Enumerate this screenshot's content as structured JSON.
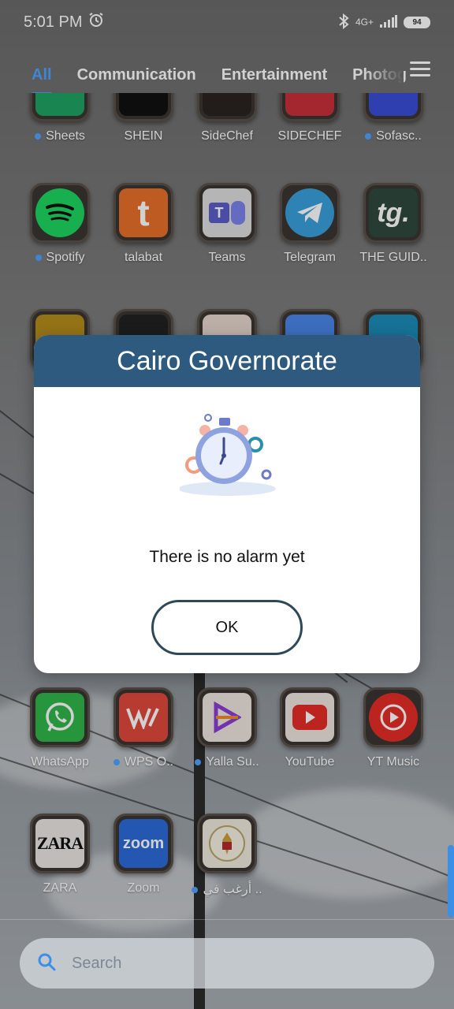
{
  "status_bar": {
    "time": "5:01 PM",
    "network": "4G+",
    "battery": "94"
  },
  "tabs": [
    {
      "label": "All"
    },
    {
      "label": "Communication"
    },
    {
      "label": "Entertainment"
    },
    {
      "label": "Photog"
    }
  ],
  "apps": {
    "row0": [
      {
        "label": "Sheets",
        "dot": true
      },
      {
        "label": "SHEIN",
        "dot": false
      },
      {
        "label": "SideChef",
        "dot": false
      },
      {
        "label": "SIDECHEF",
        "dot": false
      },
      {
        "label": "Sofasc..",
        "dot": true
      }
    ],
    "row1": [
      {
        "label": "Spotify",
        "dot": true
      },
      {
        "label": "talabat",
        "dot": false
      },
      {
        "label": "Teams",
        "dot": false
      },
      {
        "label": "Telegram",
        "dot": false
      },
      {
        "label": "THE GUID..",
        "dot": false
      }
    ],
    "row_wa": [
      {
        "label": "WhatsApp",
        "dot": false
      },
      {
        "label": "WPS O..",
        "dot": true
      },
      {
        "label": "Yalla Su..",
        "dot": true
      },
      {
        "label": "YouTube",
        "dot": false
      },
      {
        "label": "YT Music",
        "dot": false
      }
    ],
    "row_last": [
      {
        "label": "ZARA",
        "dot": false
      },
      {
        "label": "Zoom",
        "dot": false
      },
      {
        "label": "أرغب في ..",
        "dot": true
      }
    ]
  },
  "icons_text": {
    "talabat": "t",
    "teams": "T",
    "guide": "tg.",
    "zara": "ZARA",
    "zoom": "zoom"
  },
  "dialog": {
    "title": "Cairo Governorate",
    "message": "There is no alarm yet",
    "ok_label": "OK"
  },
  "search": {
    "placeholder": "Search"
  },
  "colors": {
    "accent": "#4da3ff",
    "dialog_header": "#2e5a80",
    "ok_border": "#2f4858"
  }
}
